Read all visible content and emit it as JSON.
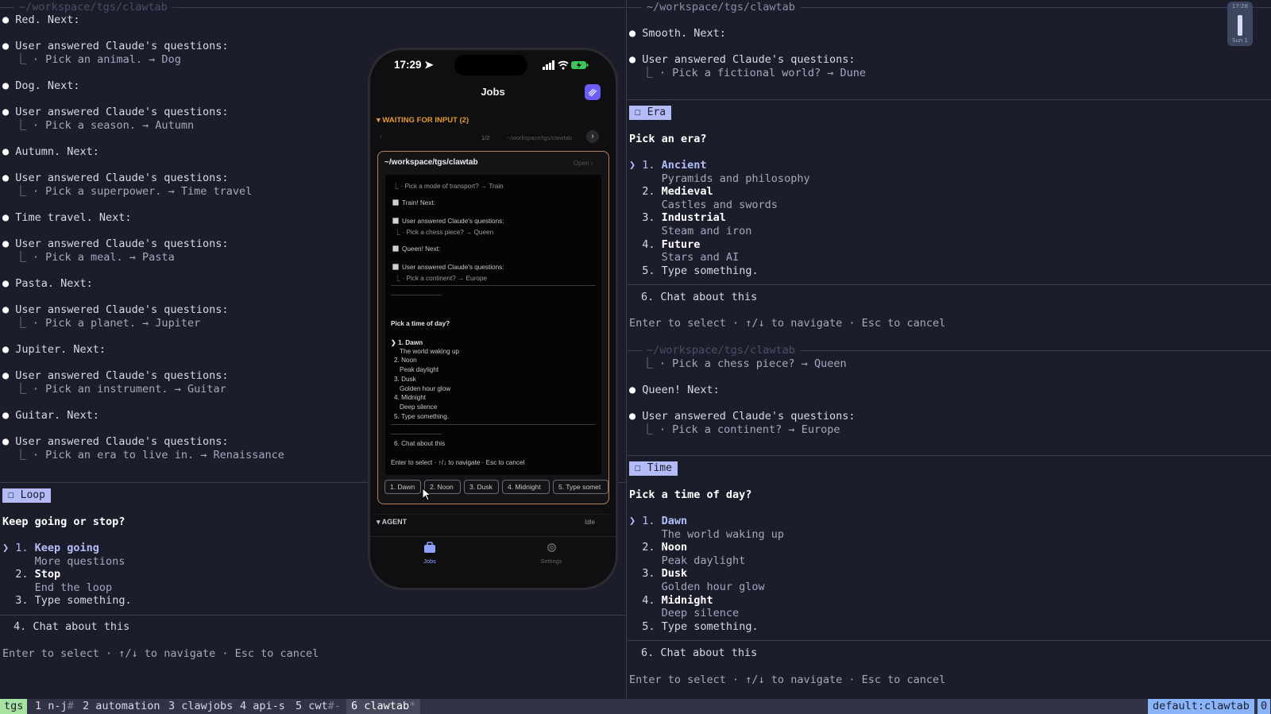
{
  "left_pane": {
    "title": "~/workspace/tgs/clawtab",
    "lines": [
      {
        "kind": "bullet",
        "text": "Red. Next:"
      },
      {
        "kind": "bullet",
        "text": "User answered Claude's questions:"
      },
      {
        "kind": "tree",
        "text": "· Pick an animal. → Dog"
      },
      {
        "kind": "bullet",
        "text": "Dog. Next:"
      },
      {
        "kind": "bullet",
        "text": "User answered Claude's questions:"
      },
      {
        "kind": "tree",
        "text": "· Pick a season. → Autumn"
      },
      {
        "kind": "bullet",
        "text": "Autumn. Next:"
      },
      {
        "kind": "bullet",
        "text": "User answered Claude's questions:"
      },
      {
        "kind": "tree",
        "text": "· Pick a superpower. → Time travel"
      },
      {
        "kind": "bullet",
        "text": "Time travel. Next:"
      },
      {
        "kind": "bullet",
        "text": "User answered Claude's questions:"
      },
      {
        "kind": "tree",
        "text": "· Pick a meal. → Pasta"
      },
      {
        "kind": "bullet",
        "text": "Pasta. Next:"
      },
      {
        "kind": "bullet",
        "text": "User answered Claude's questions:"
      },
      {
        "kind": "tree",
        "text": "· Pick a planet. → Jupiter"
      },
      {
        "kind": "bullet",
        "text": "Jupiter. Next:"
      },
      {
        "kind": "bullet",
        "text": "User answered Claude's questions:"
      },
      {
        "kind": "tree",
        "text": "· Pick an instrument. → Guitar"
      },
      {
        "kind": "bullet",
        "text": "Guitar. Next:"
      },
      {
        "kind": "bullet",
        "text": "User answered Claude's questions:"
      },
      {
        "kind": "tree",
        "text": "· Pick an era to live in. → Renaissance"
      }
    ],
    "prompt": {
      "badge": "☐ Loop",
      "question": "Keep going or stop?",
      "options": [
        {
          "num": "1.",
          "label": "Keep going",
          "desc": "More questions",
          "selected": true
        },
        {
          "num": "2.",
          "label": "Stop",
          "desc": "End the loop",
          "selected": false
        },
        {
          "num": "3.",
          "label": "Type something.",
          "desc": "",
          "selected": false
        }
      ],
      "chat": "4. Chat about this",
      "hint": "Enter to select · ↑/↓ to navigate · Esc to cancel"
    }
  },
  "right_pane": {
    "title": "~/workspace/tgs/clawtab",
    "title2": "~/workspace/tgs/clawtab",
    "top_lines": [
      {
        "kind": "bullet",
        "text": "Smooth. Next:"
      },
      {
        "kind": "bullet",
        "text": "User answered Claude's questions:"
      },
      {
        "kind": "tree",
        "text": "· Pick a fictional world? → Dune"
      }
    ],
    "era": {
      "badge": "☐ Era",
      "question": "Pick an era?",
      "options": [
        {
          "num": "1.",
          "label": "Ancient",
          "desc": "Pyramids and philosophy",
          "selected": true
        },
        {
          "num": "2.",
          "label": "Medieval",
          "desc": "Castles and swords",
          "selected": false
        },
        {
          "num": "3.",
          "label": "Industrial",
          "desc": "Steam and iron",
          "selected": false
        },
        {
          "num": "4.",
          "label": "Future",
          "desc": "Stars and AI",
          "selected": false
        },
        {
          "num": "5.",
          "label": "Type something.",
          "desc": "",
          "selected": false
        }
      ],
      "chat": "6. Chat about this",
      "hint": "Enter to select · ↑/↓ to navigate · Esc to cancel"
    },
    "mid_lines": [
      {
        "kind": "tree",
        "text": "· Pick a chess piece? → Queen"
      },
      {
        "kind": "bullet",
        "text": "Queen! Next:"
      },
      {
        "kind": "bullet",
        "text": "User answered Claude's questions:"
      },
      {
        "kind": "tree",
        "text": "· Pick a continent? → Europe"
      }
    ],
    "time": {
      "badge": "☐ Time",
      "question": "Pick a time of day?",
      "options": [
        {
          "num": "1.",
          "label": "Dawn",
          "desc": "The world waking up",
          "selected": true
        },
        {
          "num": "2.",
          "label": "Noon",
          "desc": "Peak daylight",
          "selected": false
        },
        {
          "num": "3.",
          "label": "Dusk",
          "desc": "Golden hour glow",
          "selected": false
        },
        {
          "num": "4.",
          "label": "Midnight",
          "desc": "Deep silence",
          "selected": false
        },
        {
          "num": "5.",
          "label": "Type something.",
          "desc": "",
          "selected": false
        }
      ],
      "chat": "6. Chat about this",
      "hint": "Enter to select · ↑/↓ to navigate · Esc to cancel"
    }
  },
  "clock": {
    "time": "17:28",
    "day": "Sun 1"
  },
  "statusbar": {
    "session": "tgs",
    "windows": [
      {
        "label": "1 n-j",
        "suffix": "#"
      },
      {
        "label": "2 automation",
        "suffix": ""
      },
      {
        "label": "3 clawjobs",
        "suffix": ""
      },
      {
        "label": "4 api-s",
        "suffix": ""
      },
      {
        "label": "5 cwt",
        "suffix": "#-"
      },
      {
        "label": "6 clawtab",
        "suffix": "*",
        "active": true
      }
    ],
    "right": "default:clawtab",
    "right_num": "0"
  },
  "phone": {
    "time": "17:29",
    "header_title": "Jobs",
    "section_waiting": "▾ WAITING FOR INPUT (2)",
    "pager": "1/2",
    "pager_path": "~/workspace/tgs/clawtab",
    "card_title": "~/workspace/tgs/clawtab",
    "card_open": "Open ›",
    "term_lines": [
      "· Pick a mode of transport? → Train",
      "Train! Next:",
      "User answered Claude's questions:",
      "· Pick a chess piece? → Queen",
      "Queen! Next:",
      "User answered Claude's questions:",
      "· Pick a continent? → Europe"
    ],
    "question": "Pick a time of day?",
    "options": [
      {
        "label": "1. Dawn",
        "desc": "The world waking up"
      },
      {
        "label": "2. Noon",
        "desc": "Peak daylight"
      },
      {
        "label": "3. Dusk",
        "desc": "Golden hour glow"
      },
      {
        "label": "4. Midnight",
        "desc": "Deep silence"
      },
      {
        "label": "5. Type something.",
        "desc": ""
      }
    ],
    "chat": "6. Chat about this",
    "hint": "Enter to select · ↑/↓ to navigate · Esc to cancel",
    "chips": [
      "1. Dawn",
      "2. Noon",
      "3. Dusk",
      "4. Midnight",
      "5. Type somet"
    ],
    "section_agent": "▾ AGENT",
    "agent_status": "Idle",
    "tab_jobs": "Jobs",
    "tab_settings": "Settings"
  },
  "colors": {
    "accent": "#b4bcf7",
    "card_border": "#b8835a",
    "bg": "#1c1d2b"
  }
}
